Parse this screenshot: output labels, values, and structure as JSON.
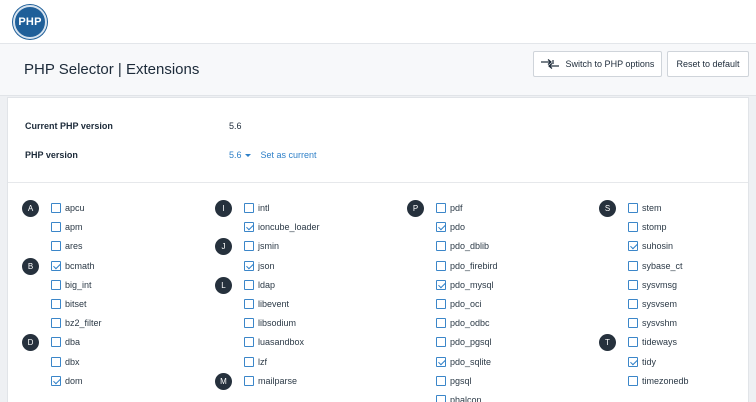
{
  "app": {
    "logo_text": "PHP"
  },
  "header": {
    "title": "PHP Selector | Extensions",
    "switch_label": "Switch to PHP options",
    "reset_label": "Reset to default"
  },
  "info": {
    "current_label": "Current PHP version",
    "current_value": "5.6",
    "version_label": "PHP version",
    "version_value": "5.6",
    "set_current_label": "Set as current"
  },
  "colors": {
    "accent": "#2f80c8",
    "letter_badge": "#26313d",
    "logo": "#1f5f99"
  },
  "columns": [
    {
      "groups": [
        {
          "letter": "A",
          "items": [
            {
              "name": "apcu",
              "checked": false
            },
            {
              "name": "apm",
              "checked": false
            },
            {
              "name": "ares",
              "checked": false
            }
          ]
        },
        {
          "letter": "B",
          "items": [
            {
              "name": "bcmath",
              "checked": true
            },
            {
              "name": "big_int",
              "checked": false
            },
            {
              "name": "bitset",
              "checked": false
            },
            {
              "name": "bz2_filter",
              "checked": false
            }
          ]
        },
        {
          "letter": "D",
          "items": [
            {
              "name": "dba",
              "checked": false
            },
            {
              "name": "dbx",
              "checked": false
            },
            {
              "name": "dom",
              "checked": true
            }
          ]
        }
      ]
    },
    {
      "groups": [
        {
          "letter": "I",
          "items": [
            {
              "name": "intl",
              "checked": false
            },
            {
              "name": "ioncube_loader",
              "checked": true
            }
          ]
        },
        {
          "letter": "J",
          "items": [
            {
              "name": "jsmin",
              "checked": false
            },
            {
              "name": "json",
              "checked": true
            }
          ]
        },
        {
          "letter": "L",
          "items": [
            {
              "name": "ldap",
              "checked": false
            },
            {
              "name": "libevent",
              "checked": false
            },
            {
              "name": "libsodium",
              "checked": false
            },
            {
              "name": "luasandbox",
              "checked": false
            },
            {
              "name": "lzf",
              "checked": false
            }
          ]
        },
        {
          "letter": "M",
          "items": [
            {
              "name": "mailparse",
              "checked": false
            }
          ]
        }
      ]
    },
    {
      "groups": [
        {
          "letter": "P",
          "items": [
            {
              "name": "pdf",
              "checked": false
            },
            {
              "name": "pdo",
              "checked": true
            },
            {
              "name": "pdo_dblib",
              "checked": false
            },
            {
              "name": "pdo_firebird",
              "checked": false
            },
            {
              "name": "pdo_mysql",
              "checked": true
            },
            {
              "name": "pdo_oci",
              "checked": false
            },
            {
              "name": "pdo_odbc",
              "checked": false
            },
            {
              "name": "pdo_pgsql",
              "checked": false
            },
            {
              "name": "pdo_sqlite",
              "checked": true
            },
            {
              "name": "pgsql",
              "checked": false
            },
            {
              "name": "phalcon",
              "checked": false
            }
          ]
        }
      ]
    },
    {
      "groups": [
        {
          "letter": "S",
          "items": [
            {
              "name": "stem",
              "checked": false
            },
            {
              "name": "stomp",
              "checked": false
            },
            {
              "name": "suhosin",
              "checked": true
            },
            {
              "name": "sybase_ct",
              "checked": false
            },
            {
              "name": "sysvmsg",
              "checked": false
            },
            {
              "name": "sysvsem",
              "checked": false
            },
            {
              "name": "sysvshm",
              "checked": false
            }
          ]
        },
        {
          "letter": "T",
          "items": [
            {
              "name": "tideways",
              "checked": false
            },
            {
              "name": "tidy",
              "checked": true
            },
            {
              "name": "timezonedb",
              "checked": false
            }
          ]
        }
      ]
    }
  ]
}
